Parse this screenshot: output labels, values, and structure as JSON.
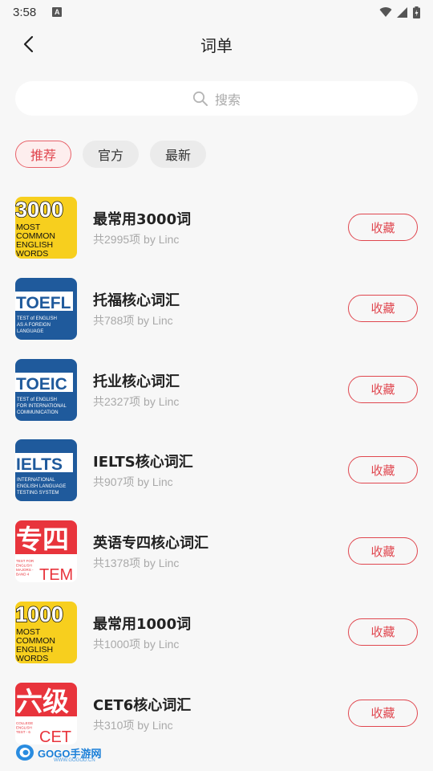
{
  "status": {
    "time": "3:58",
    "indicator": "A"
  },
  "header": {
    "title": "词单",
    "back_icon": "chevron-left-icon"
  },
  "search": {
    "placeholder": "搜索",
    "icon": "search-icon"
  },
  "tabs": [
    {
      "label": "推荐",
      "active": true
    },
    {
      "label": "官方",
      "active": false
    },
    {
      "label": "最新",
      "active": false
    }
  ],
  "items": [
    {
      "title": "最常用3000词",
      "subtitle": "共2995项 by Linc",
      "button": "收藏",
      "thumb": {
        "kind": "most",
        "big": "3000",
        "lines": [
          "MOST",
          "COMMON",
          "ENGLISH",
          "WORDS"
        ],
        "bg": "#f7cf1e"
      }
    },
    {
      "title": "托福核心词汇",
      "subtitle": "共788项 by Linc",
      "button": "收藏",
      "thumb": {
        "kind": "exam",
        "big": "TOEFL",
        "lines": [
          "TEST of ENGLISH",
          "AS A FOREIGN",
          "LANGUAGE"
        ],
        "bg": "#1f5a9c"
      }
    },
    {
      "title": "托业核心词汇",
      "subtitle": "共2327项 by Linc",
      "button": "收藏",
      "thumb": {
        "kind": "exam",
        "big": "TOEIC",
        "lines": [
          "TEST of ENGLISH",
          "FOR INTERNATIONAL",
          "COMMUNICATION"
        ],
        "bg": "#1f5a9c"
      }
    },
    {
      "title": "IELTS核心词汇",
      "subtitle": "共907项 by Linc",
      "button": "收藏",
      "thumb": {
        "kind": "exam",
        "big": "IELTS",
        "lines": [
          "INTERNATIONAL",
          "ENGLISH LANGUAGE",
          "TESTING SYSTEM"
        ],
        "bg": "#1f5a9c"
      }
    },
    {
      "title": "英语专四核心词汇",
      "subtitle": "共1378项 by Linc",
      "button": "收藏",
      "thumb": {
        "kind": "tem",
        "big": "专四",
        "code": "TEM",
        "lines": [
          "TEST FOR",
          "ENGLISH",
          "MAJORS -",
          "BAND 4"
        ],
        "bg": "#e8343c"
      }
    },
    {
      "title": "最常用1000词",
      "subtitle": "共1000项 by Linc",
      "button": "收藏",
      "thumb": {
        "kind": "most",
        "big": "1000",
        "lines": [
          "MOST",
          "COMMON",
          "ENGLISH",
          "WORDS"
        ],
        "bg": "#f7cf1e"
      }
    },
    {
      "title": "CET6核心词汇",
      "subtitle": "共310项 by Linc",
      "button": "收藏",
      "thumb": {
        "kind": "tem",
        "big": "六级",
        "code": "CET",
        "lines": [
          "COLLEGE",
          "ENGLISH",
          "TEST - 6"
        ],
        "bg": "#e8343c"
      }
    }
  ],
  "watermark": {
    "text": "GOGO手游网",
    "url": "WWW.GOGOD.CN"
  },
  "colors": {
    "accent": "#e0474f",
    "exam_blue": "#1f5a9c",
    "yellow": "#f7cf1e",
    "tem_red": "#e8343c"
  }
}
